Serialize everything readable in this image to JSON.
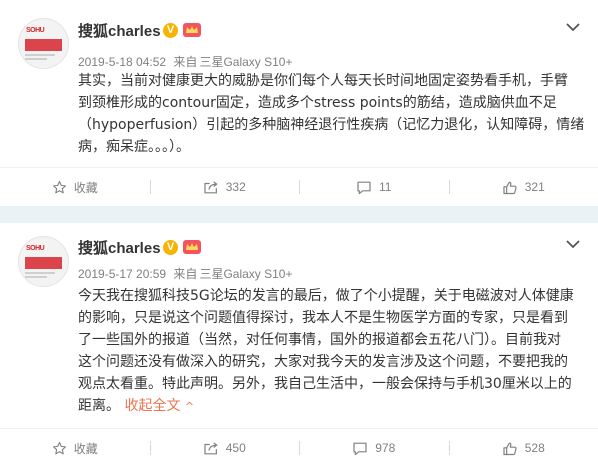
{
  "posts": [
    {
      "username": "搜狐charles",
      "verified_badge": "V",
      "timestamp": "2019-5-18 04:52",
      "source_prefix": "来自",
      "source_device": "三星Galaxy S10+",
      "content_lines": [
        "其实，当前对健康更大的威胁是你们每个人每天长时间地固定姿势看手机，手臂",
        "到颈椎形成的contour固定，造成多个stress points的筋结，造成脑供血不足",
        "（hypoperfusion）引起的多种脑神经退行性疾病（记忆力退化，认知障碍，情绪",
        "病，痴呆症。。。）。"
      ],
      "actions": {
        "favorite": "收藏",
        "repost": "332",
        "comment": "11",
        "like": "321"
      }
    },
    {
      "username": "搜狐charles",
      "verified_badge": "V",
      "timestamp": "2019-5-17 20:59",
      "source_prefix": "来自",
      "source_device": "三星Galaxy S10+",
      "content_lines": [
        "今天我在搜狐科技5G论坛的发言的最后，做了个小提醒，关于电磁波对人体健康",
        "的影响，只是说这个问题值得探讨，我本人不是生物医学方面的专家，只是看到",
        "了一些国外的报道（当然，对任何事情，国外的报道都会五花八门）。目前我对",
        "这个问题还没有做深入的研究，大家对我今天的发言涉及这个问题，不要把我的",
        "观点太看重。特此声明。另外，我自己生活中，一般会保持与手机30厘米以上的"
      ],
      "content_last_line": "距离。",
      "expand_label": "收起全文",
      "expand_arrow": "^",
      "actions": {
        "favorite": "收藏",
        "repost": "450",
        "comment": "978",
        "like": "528"
      }
    }
  ],
  "colors": {
    "background": "#e9f2f5",
    "accent": "#eb7350",
    "muted": "#808080",
    "text": "#333333",
    "badge": "#f6b400"
  }
}
